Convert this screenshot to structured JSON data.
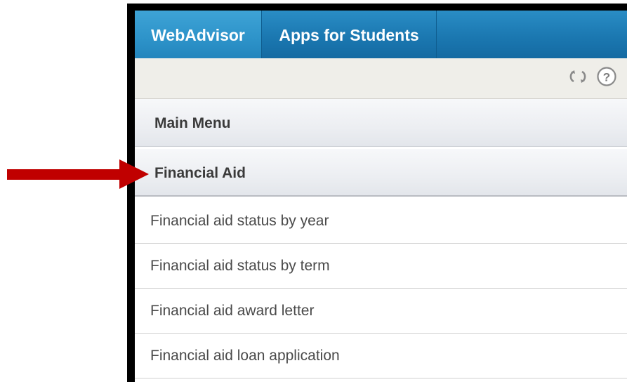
{
  "tabs": [
    {
      "label": "WebAdvisor",
      "active": true
    },
    {
      "label": "Apps for Students",
      "active": false
    }
  ],
  "toolbar": {
    "icons": [
      "refresh-icon",
      "help-icon"
    ]
  },
  "menu": {
    "main_menu_label": "Main Menu",
    "section_label": "Financial Aid",
    "items": [
      {
        "label": "Financial aid status by year"
      },
      {
        "label": "Financial aid status by term"
      },
      {
        "label": "Financial aid award letter"
      },
      {
        "label": "Financial aid loan application"
      }
    ]
  },
  "colors": {
    "tab_bar": "#1b78b1",
    "active_tab": "#2d93c9",
    "toolbar_bg": "#efeee9",
    "arrow": "#c00000"
  }
}
